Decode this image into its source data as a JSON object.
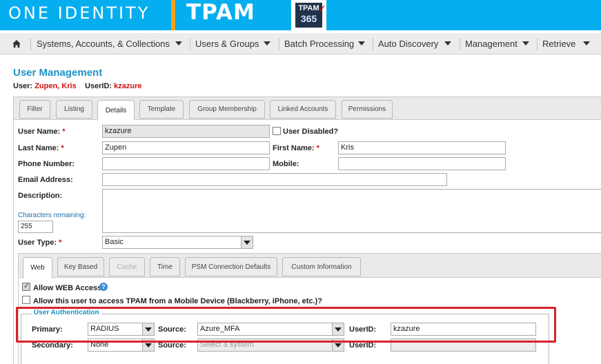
{
  "header": {
    "brand": "ONE IDENTITY",
    "product": "TPAM",
    "badge_top": "TPAM",
    "badge_num": "365",
    "accent": "#04aeef"
  },
  "nav": {
    "items": [
      {
        "label": "Systems, Accounts, & Collections"
      },
      {
        "label": "Users & Groups"
      },
      {
        "label": "Batch Processing"
      },
      {
        "label": "Auto Discovery"
      },
      {
        "label": "Management"
      },
      {
        "label": "Retrieve"
      }
    ]
  },
  "page": {
    "title": "User Management",
    "user_key": "User:",
    "user_value": "Zupen, Kris",
    "userid_key": "UserID:",
    "userid_value": "kzazure"
  },
  "tabs": [
    {
      "label": "Filter"
    },
    {
      "label": "Listing"
    },
    {
      "label": "Details"
    },
    {
      "label": "Template"
    },
    {
      "label": "Group Membership"
    },
    {
      "label": "Linked Accounts"
    },
    {
      "label": "Permissions"
    }
  ],
  "form": {
    "user_name_label": "User Name:",
    "user_name_value": "kzazure",
    "user_disabled_label": "User Disabled?",
    "last_name_label": "Last Name:",
    "last_name_value": "Zupen",
    "first_name_label": "First Name:",
    "first_name_value": "Kris",
    "phone_label": "Phone Number:",
    "phone_value": "",
    "mobile_label": "Mobile:",
    "mobile_value": "",
    "email_label": "Email Address:",
    "email_value": "",
    "description_label": "Description:",
    "description_value": "",
    "chars_remaining_label": "Characters remaining:",
    "chars_remaining_value": "255",
    "user_type_label": "User Type:",
    "user_type_value": "Basic",
    "required_mark": "*"
  },
  "inner_tabs": [
    {
      "label": "Web"
    },
    {
      "label": "Key Based"
    },
    {
      "label": "Cache"
    },
    {
      "label": "Time"
    },
    {
      "label": "PSM Connection Defaults"
    },
    {
      "label": "Custom Information"
    }
  ],
  "web": {
    "allow_web_label": "Allow WEB Access",
    "allow_mobile_label": "Allow this user to access TPAM from a Mobile Device (Blackberry, iPhone, etc.)?",
    "auth_legend": "User Authentication",
    "primary_label": "Primary:",
    "primary_value": "RADIUS",
    "source_label": "Source:",
    "primary_source_value": "Azure_MFA",
    "userid_label": "UserID:",
    "primary_userid_value": "kzazure",
    "secondary_label": "Secondary:",
    "secondary_value": "None",
    "secondary_source_placeholder": "Select a system",
    "secondary_userid_value": ""
  }
}
